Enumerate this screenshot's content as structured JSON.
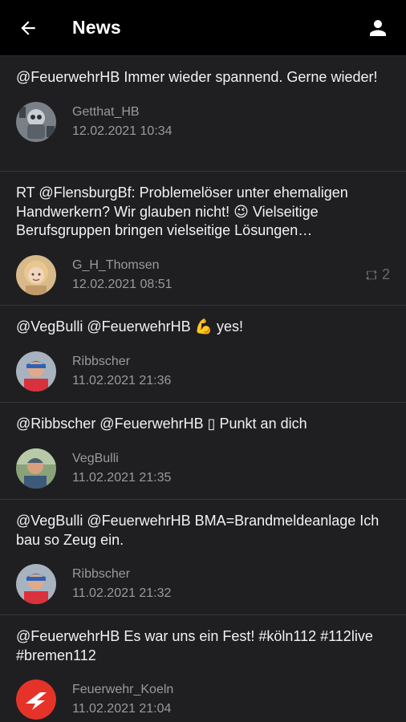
{
  "header": {
    "title": "News",
    "back_icon": "arrow-left-icon",
    "profile_icon": "person-icon"
  },
  "tweets": [
    {
      "text": "@FeuerwehrHB Immer wieder spannend. Gerne wieder!",
      "author": "Getthat_HB",
      "time": "12.02.2021 10:34",
      "avatar": "robot-avatar"
    },
    {
      "text": "RT @FlensburgBf: Problemelöser unter ehemaligen Handwerkern? Wir glauben nicht! 😉  Vielseitige Berufsgruppen bringen vielseitige Lösungen…",
      "author": "G_H_Thomsen",
      "time": "12.02.2021 08:51",
      "avatar": "woman-avatar",
      "retweets": "2"
    },
    {
      "text": "@VegBulli @FeuerwehrHB 💪 yes!",
      "author": "Ribbscher",
      "time": "11.02.2021 21:36",
      "avatar": "man-cap-avatar"
    },
    {
      "text": "@Ribbscher @FeuerwehrHB ▯ Punkt an dich",
      "author": "VegBulli",
      "time": "11.02.2021 21:35",
      "avatar": "man-outdoor-avatar"
    },
    {
      "text": "@VegBulli @FeuerwehrHB BMA=Brandmeldeanlage Ich bau so Zeug ein.",
      "author": "Ribbscher",
      "time": "11.02.2021 21:32",
      "avatar": "man-cap-avatar"
    },
    {
      "text": "@FeuerwehrHB Es war uns ein Fest! #köln112 #112live #bremen112",
      "author": "Feuerwehr_Koeln",
      "time": "11.02.2021 21:04",
      "avatar": "fire-dept-logo"
    }
  ]
}
